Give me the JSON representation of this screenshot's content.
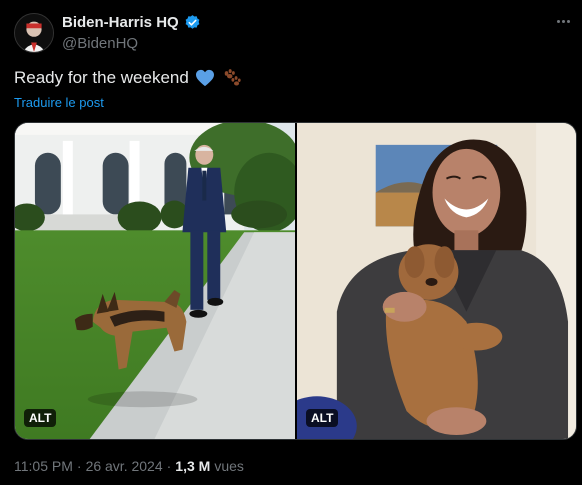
{
  "author": {
    "display_name": "Biden-Harris HQ",
    "handle": "@BidenHQ",
    "verified_icon": "verified-badge-icon",
    "avatar_icon": "avatar-portrait-icon"
  },
  "tweet": {
    "text": "Ready for the weekend",
    "emojis": [
      "blue-heart-icon",
      "paw-prints-icon"
    ],
    "translate_label": "Traduire le post"
  },
  "media": {
    "left_alt_badge": "ALT",
    "right_alt_badge": "ALT"
  },
  "meta": {
    "time": "11:05 PM",
    "separator": "·",
    "date": "26 avr. 2024",
    "views_count": "1,3 M",
    "views_label": "vues"
  },
  "colors": {
    "background": "#000000",
    "text": "#e7e9ea",
    "secondary": "#71767b",
    "link": "#1d9bf0",
    "verified": "#1d9bf0"
  }
}
